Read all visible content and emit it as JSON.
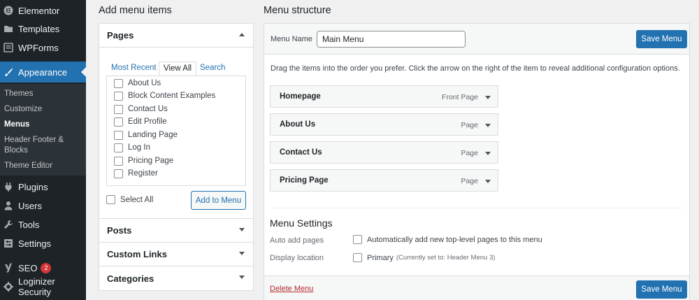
{
  "sidebar": {
    "top_items": [
      {
        "label": "Elementor",
        "icon": "elementor-icon"
      },
      {
        "label": "Templates",
        "icon": "folder-icon"
      },
      {
        "label": "WPForms",
        "icon": "wpforms-icon"
      }
    ],
    "active_item": {
      "label": "Appearance",
      "icon": "brush-icon"
    },
    "submenu": [
      {
        "label": "Themes"
      },
      {
        "label": "Customize"
      },
      {
        "label": "Menus"
      },
      {
        "label": "Header Footer &"
      },
      {
        "label": "Blocks"
      },
      {
        "label": "Theme Editor"
      }
    ],
    "bottom_items": [
      {
        "label": "Plugins",
        "icon": "plugin-icon"
      },
      {
        "label": "Users",
        "icon": "users-icon"
      },
      {
        "label": "Tools",
        "icon": "wrench-icon"
      },
      {
        "label": "Settings",
        "icon": "settings-icon"
      }
    ],
    "seo": {
      "label": "SEO",
      "badge": "2",
      "icon": "yoast-icon"
    },
    "security": {
      "label": "Loginizer Security",
      "icon": "gear-icon"
    }
  },
  "add_items": {
    "heading": "Add menu items",
    "pages": {
      "title": "Pages",
      "tabs": [
        "Most Recent",
        "View All",
        "Search"
      ],
      "items": [
        "About Us",
        "Block Content Examples",
        "Contact Us",
        "Edit Profile",
        "Landing Page",
        "Log In",
        "Pricing Page",
        "Register"
      ],
      "select_all": "Select All",
      "add_button": "Add to Menu"
    },
    "sections": [
      "Posts",
      "Custom Links",
      "Categories"
    ]
  },
  "structure": {
    "heading": "Menu structure",
    "menu_name_label": "Menu Name",
    "menu_name_value": "Main Menu",
    "save_label": "Save Menu",
    "instructions": "Drag the items into the order you prefer. Click the arrow on the right of the item to reveal additional configuration options.",
    "items": [
      {
        "title": "Homepage",
        "type": "Front Page"
      },
      {
        "title": "About Us",
        "type": "Page"
      },
      {
        "title": "Contact Us",
        "type": "Page"
      },
      {
        "title": "Pricing Page",
        "type": "Page"
      }
    ],
    "settings": {
      "title": "Menu Settings",
      "auto_add_label": "Auto add pages",
      "auto_add_option": "Automatically add new top-level pages to this menu",
      "display_label": "Display location",
      "display_option": "Primary",
      "display_note": "(Currently set to: Header Menu 3)"
    },
    "delete_label": "Delete Menu"
  },
  "colors": {
    "sidebar_bg": "#1d2327",
    "accent": "#2271b1",
    "danger": "#b32d2e",
    "badge": "#d63638"
  }
}
